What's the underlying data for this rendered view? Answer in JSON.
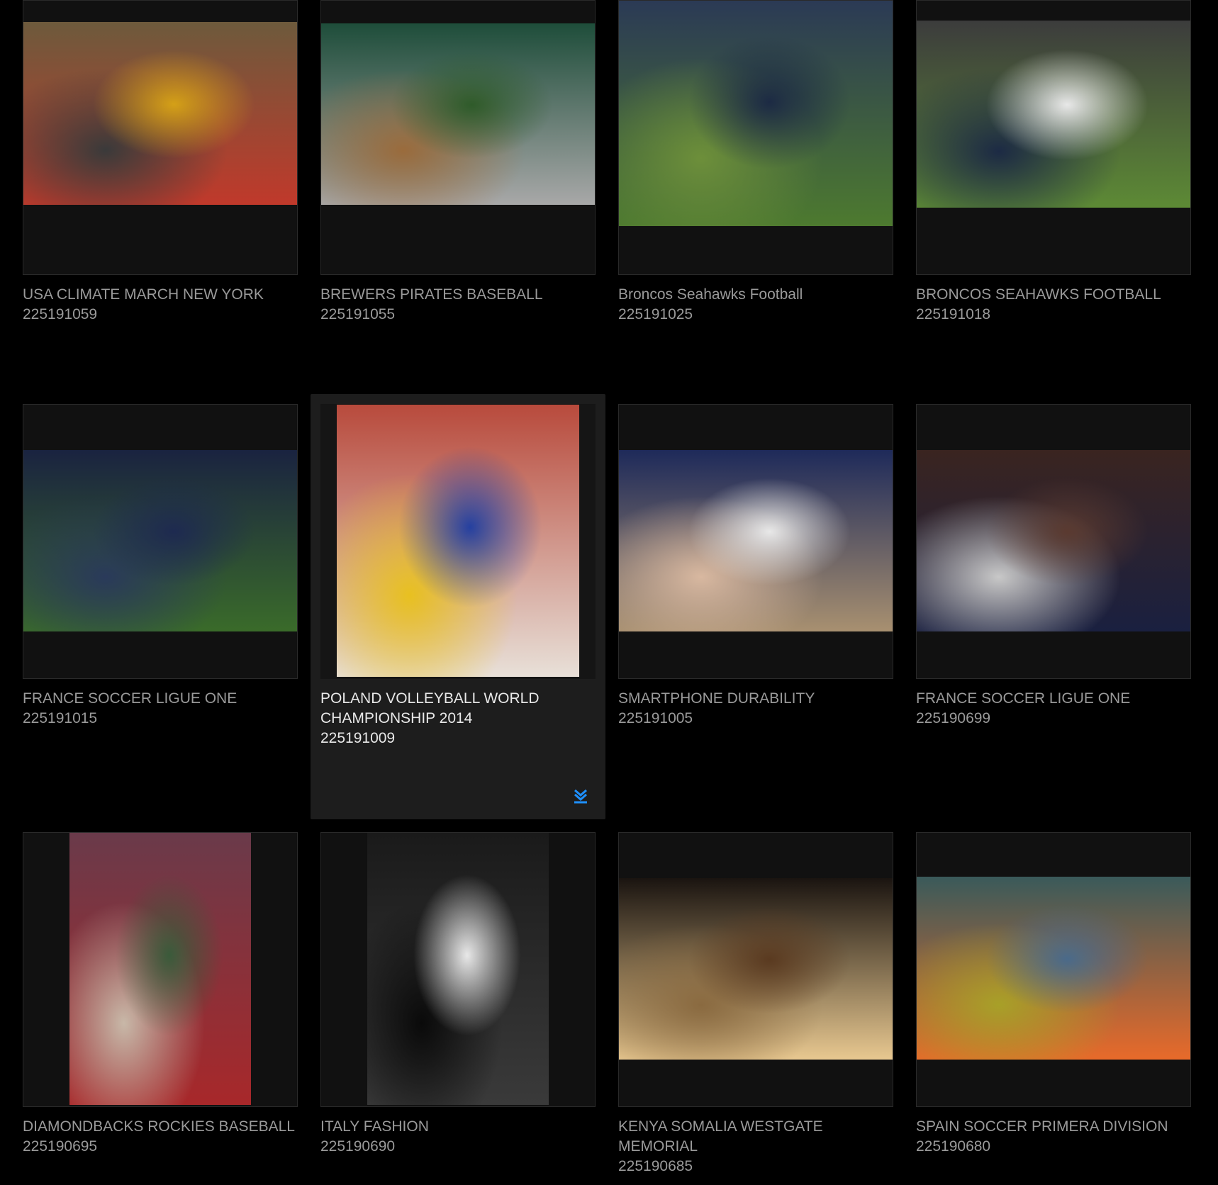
{
  "items": [
    {
      "title": "USA CLIMATE MARCH NEW YORK",
      "id": "225191059",
      "photo_colors": [
        "#6d5a3c",
        "#c0392b",
        "#d4a017",
        "#3a3a3a"
      ]
    },
    {
      "title": "BREWERS PIRATES BASEBALL",
      "id": "225191055",
      "photo_colors": [
        "#1e4d3a",
        "#a8a8a8",
        "#2f5b2a",
        "#9a6b3c"
      ]
    },
    {
      "title": "Broncos Seahawks Football",
      "id": "225191025",
      "photo_colors": [
        "#2b3a55",
        "#4d7a2f",
        "#1c2a44",
        "#6d8f3a"
      ]
    },
    {
      "title": "BRONCOS SEAHAWKS FOOTBALL",
      "id": "225191018",
      "photo_colors": [
        "#3c3c3c",
        "#5d8a35",
        "#e8e8e8",
        "#1c2a44"
      ]
    },
    {
      "title": "FRANCE SOCCER LIGUE ONE",
      "id": "225191015",
      "photo_colors": [
        "#1a2340",
        "#3a6b2a",
        "#1e2a50",
        "#2a3a5a"
      ]
    },
    {
      "title": "POLAND VOLLEYBALL WORLD CHAMPIONSHIP 2014",
      "id": "225191009",
      "photo_colors": [
        "#b84a3c",
        "#e8e0d8",
        "#2540a0",
        "#e8c020"
      ]
    },
    {
      "title": "SMARTPHONE DURABILITY",
      "id": "225191005",
      "photo_colors": [
        "#1e2a5a",
        "#a89070",
        "#e8e8e8",
        "#d8b8a0"
      ]
    },
    {
      "title": "FRANCE SOCCER LIGUE ONE",
      "id": "225190699",
      "photo_colors": [
        "#3a2420",
        "#1a2040",
        "#5a3a30",
        "#c8c8c8"
      ]
    },
    {
      "title": "DIAMONDBACKS ROCKIES BASEBALL",
      "id": "225190695",
      "photo_colors": [
        "#6a3a4a",
        "#a8282a",
        "#3a5a3a",
        "#c8b8a8"
      ]
    },
    {
      "title": "ITALY FASHION",
      "id": "225190690",
      "photo_colors": [
        "#1a1a1a",
        "#3a3a3a",
        "#e8e8e8",
        "#0a0a0a"
      ]
    },
    {
      "title": "KENYA SOMALIA WESTGATE MEMORIAL",
      "id": "225190685",
      "photo_colors": [
        "#1a1410",
        "#e8c890",
        "#5a3a20",
        "#8a6a40"
      ]
    },
    {
      "title": "SPAIN SOCCER PRIMERA DIVISION",
      "id": "225190680",
      "photo_colors": [
        "#3a5a5a",
        "#e86a2a",
        "#4a6a8a",
        "#a8a028"
      ]
    }
  ],
  "download_icon_color": "#1e90ff"
}
